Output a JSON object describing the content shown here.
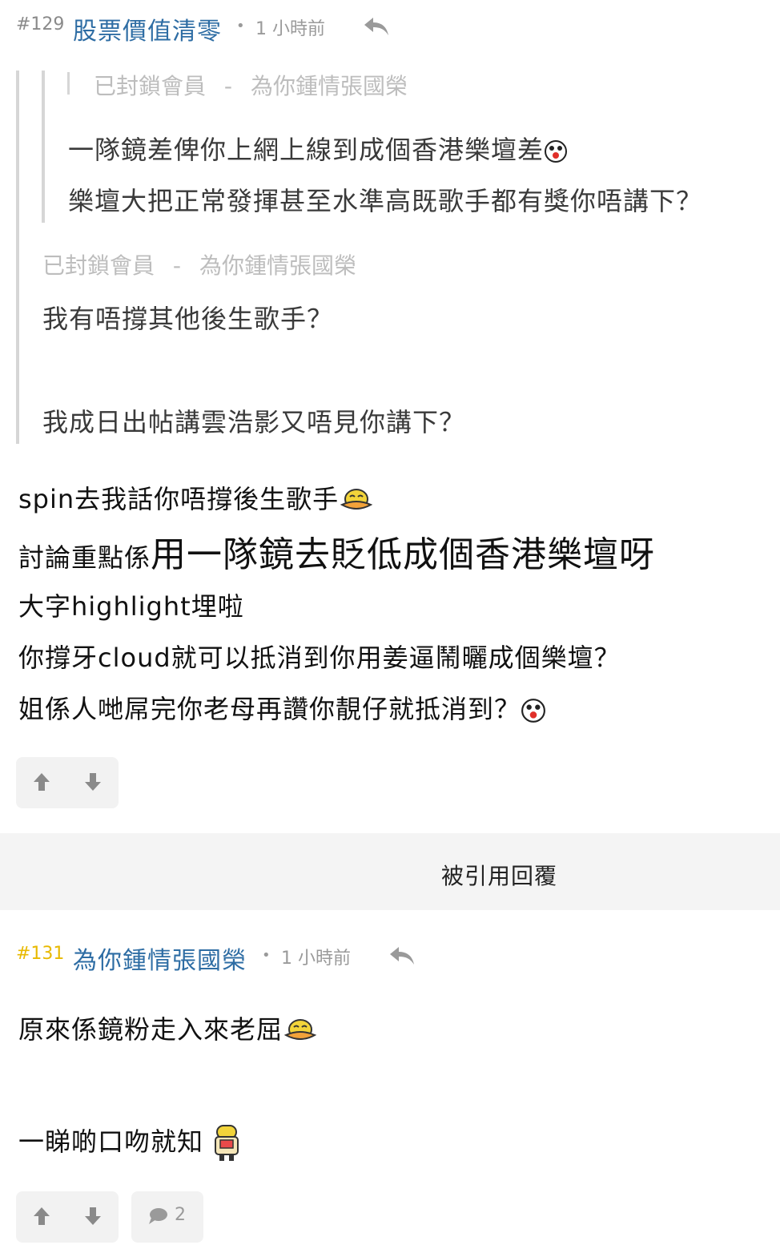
{
  "post129": {
    "number": "#129",
    "author": "股票價值清零",
    "dot": "•",
    "time": "1 小時前",
    "quote_outer": {
      "inner": {
        "header_blocked": "已封鎖會員",
        "header_sep": "-",
        "header_author": "為你鍾情張國榮",
        "line1": "一隊鏡差俾你上網上線到成個香港樂壇差",
        "line2": "樂壇大把正常發揮甚至水準高既歌手都有獎你唔講下？"
      },
      "header_blocked": "已封鎖會員",
      "header_sep": "-",
      "header_author": "為你鍾情張國榮",
      "line1": "我有唔撐其他後生歌手？",
      "line2": "我成日出帖講雲浩影又唔見你講下？"
    },
    "body": {
      "line1": "spin去我話你唔撐後生歌手",
      "line2_small": "討論重點係",
      "line2_big": "用一隊鏡去貶低成個香港樂壇呀",
      "line3": "大字highlight埋啦",
      "line4": "你撐牙cloud就可以抵消到你用姜逼鬧曬成個樂壇？",
      "line5": "姐係人哋屌完你老母再讚你靚仔就抵消到？"
    }
  },
  "quoted_replies_label": "被引用回覆",
  "post131": {
    "number": "#131",
    "author": "為你鍾情張國榮",
    "dot": "•",
    "time": "1 小時前",
    "line1": "原來係鏡粉走入來老屈",
    "line2": "一睇啲口吻就知",
    "reply_count": "2"
  },
  "colors": {
    "username": "#2e6da4",
    "post_number_gold": "#e8b900",
    "quote_bar": "#d6d6d6",
    "vote_bg": "#f2f2f2"
  },
  "icons": [
    "reply-icon",
    "upvote-icon",
    "downvote-icon",
    "comment-icon",
    "shocked-emoji",
    "laughing-duck-emoji",
    "blushing-emoji"
  ]
}
